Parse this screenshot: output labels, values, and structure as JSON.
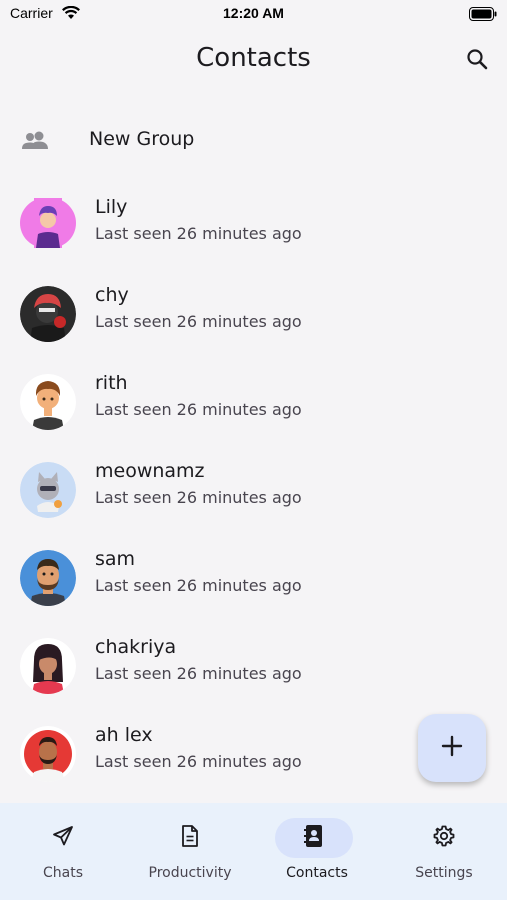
{
  "status_bar": {
    "carrier": "Carrier",
    "time": "12:20 AM"
  },
  "header": {
    "title": "Contacts"
  },
  "new_group": {
    "label": "New Group",
    "icon": "group-icon"
  },
  "contacts": [
    {
      "name": "Lily",
      "status": "Last seen 26 minutes ago",
      "avatar_bg": "#f07be7"
    },
    {
      "name": "chy",
      "status": "Last seen 26 minutes ago",
      "avatar_bg": "#2b2b2b"
    },
    {
      "name": "rith",
      "status": "Last seen 26 minutes ago",
      "avatar_bg": "#ffffff"
    },
    {
      "name": "meownamz",
      "status": "Last seen 26 minutes ago",
      "avatar_bg": "#c9dcf5"
    },
    {
      "name": "sam",
      "status": "Last seen 26 minutes ago",
      "avatar_bg": "#4a90d9"
    },
    {
      "name": "chakriya",
      "status": "Last seen 26 minutes ago",
      "avatar_bg": "#ffffff"
    },
    {
      "name": "ah lex",
      "status": "Last seen 26 minutes ago",
      "avatar_bg": "#e53935"
    }
  ],
  "fab": {
    "icon": "plus-icon"
  },
  "bottom_nav": {
    "items": [
      {
        "label": "Chats",
        "icon": "send-icon",
        "active": false
      },
      {
        "label": "Productivity",
        "icon": "document-icon",
        "active": false
      },
      {
        "label": "Contacts",
        "icon": "contacts-book-icon",
        "active": true
      },
      {
        "label": "Settings",
        "icon": "gear-icon",
        "active": false
      }
    ]
  },
  "colors": {
    "background": "#f5f4f6",
    "accent": "#d8e2fb",
    "nav_bg": "#e9f1fb",
    "text": "#1c1b1f",
    "subtext": "#49454f"
  }
}
